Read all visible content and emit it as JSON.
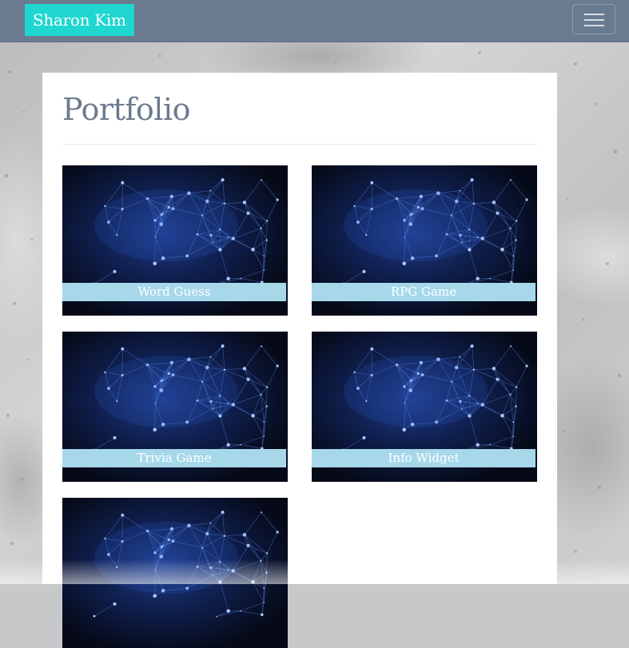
{
  "navbar": {
    "brand": "Sharon Kim",
    "brand_color": "#1fd6d0",
    "background_color": "#6b7b8f",
    "toggler_icon": "hamburger-menu-icon"
  },
  "main": {
    "title": "Portfolio",
    "title_color": "#6b7b8f",
    "projects": [
      {
        "label": "Word Guess"
      },
      {
        "label": "RPG Game"
      },
      {
        "label": "Trivia Game"
      },
      {
        "label": "Info Widget"
      },
      {
        "label": ""
      }
    ],
    "caption_color": "#a6d8ea"
  }
}
